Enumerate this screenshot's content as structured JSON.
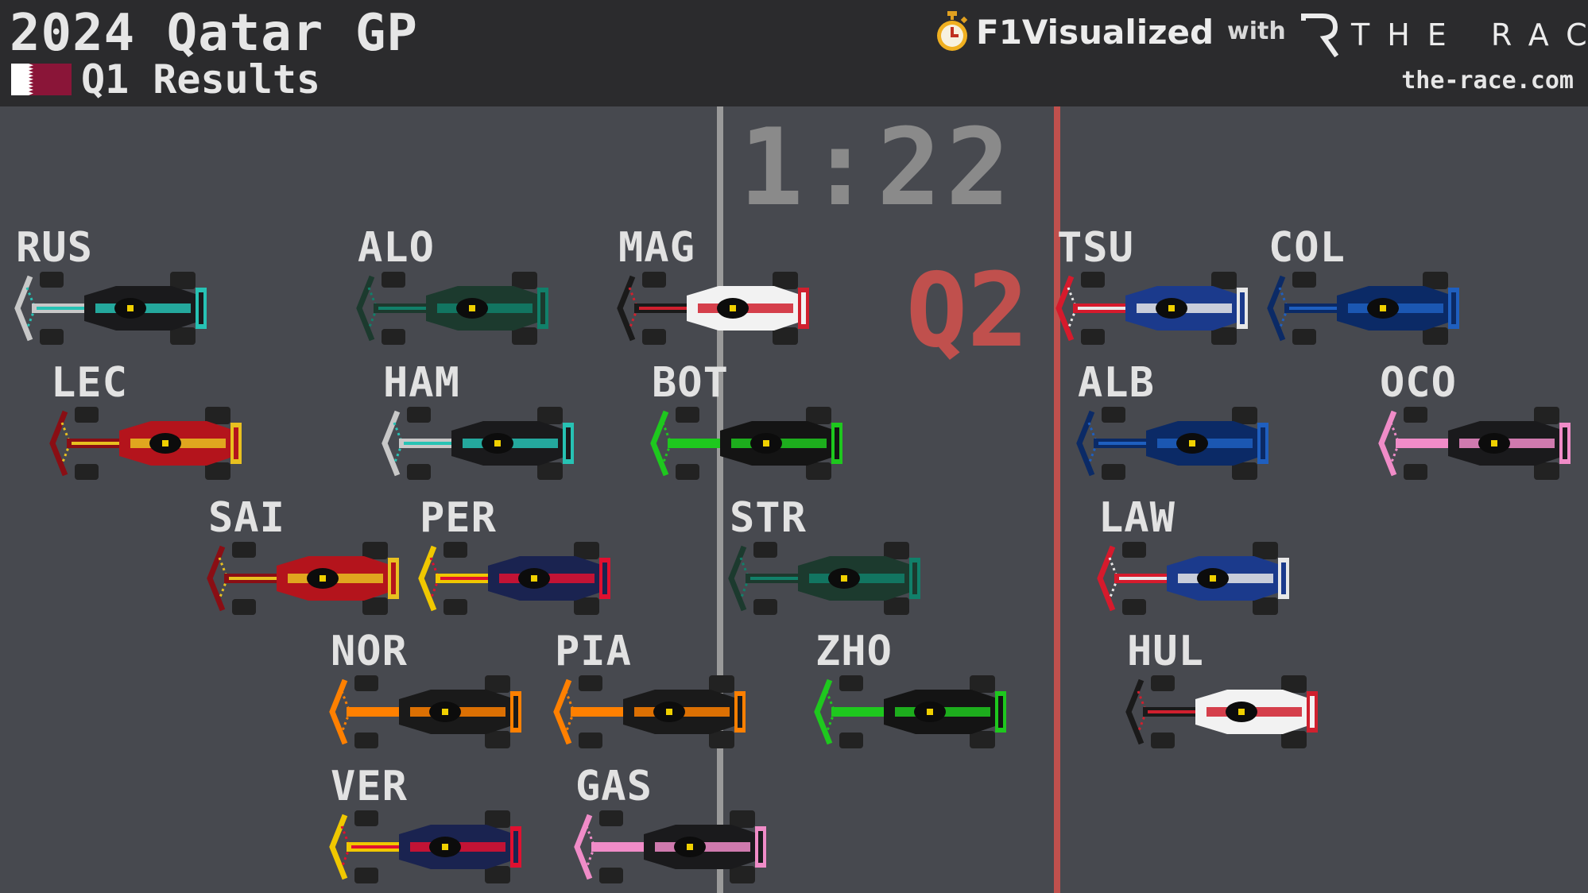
{
  "header": {
    "title": "2024 Qatar GP",
    "subtitle": "Q1 Results",
    "brand": "F1Visualized",
    "with_text": "with",
    "partner": "THE RACE",
    "url": "the-race.com"
  },
  "timer": "1:22",
  "cutoff_label": "Q2",
  "colors": {
    "header_bg": "#2b2b2d",
    "track_bg": "#47494f",
    "center_line": "#9a9a9a",
    "cutoff_line": "#c0504d",
    "cutoff_text": "#c0504d",
    "flag_white": "#ffffff",
    "flag_maroon": "#8a1538"
  },
  "icons": [
    "stopwatch-icon",
    "qatar-flag-icon",
    "the-race-logo-icon"
  ],
  "drivers": [
    {
      "code": "RUS",
      "team": "mercedes",
      "body": "#1a1a1c",
      "accent": "#27c2b4",
      "nose": "#c8c8c8",
      "row": 1
    },
    {
      "code": "ALO",
      "team": "aston-martin",
      "body": "#1c3a2e",
      "accent": "#11806a",
      "nose": "#1c3a2e",
      "row": 1
    },
    {
      "code": "MAG",
      "team": "haas",
      "body": "#f2f2f2",
      "accent": "#d0202e",
      "nose": "#1a1a1a",
      "row": 1
    },
    {
      "code": "TSU",
      "team": "rb",
      "body": "#1b3a8c",
      "accent": "#e8e8e8",
      "nose": "#d61a2c",
      "row": 1
    },
    {
      "code": "COL",
      "team": "williams",
      "body": "#0b2a66",
      "accent": "#1f5fbf",
      "nose": "#0b2a66",
      "row": 1
    },
    {
      "code": "LEC",
      "team": "ferrari",
      "body": "#b4141c",
      "accent": "#e8c020",
      "nose": "#8a0e14",
      "row": 2
    },
    {
      "code": "HAM",
      "team": "mercedes",
      "body": "#1a1a1c",
      "accent": "#27c2b4",
      "nose": "#c8c8c8",
      "row": 2
    },
    {
      "code": "BOT",
      "team": "sauber",
      "body": "#141414",
      "accent": "#1ec81e",
      "nose": "#1ec81e",
      "row": 2
    },
    {
      "code": "ALB",
      "team": "williams",
      "body": "#0b2a66",
      "accent": "#1f5fbf",
      "nose": "#0b2a66",
      "row": 2
    },
    {
      "code": "OCO",
      "team": "alpine",
      "body": "#1a1a1c",
      "accent": "#f08cc8",
      "nose": "#f08cc8",
      "row": 2
    },
    {
      "code": "SAI",
      "team": "ferrari",
      "body": "#b4141c",
      "accent": "#e8c020",
      "nose": "#8a0e14",
      "row": 3
    },
    {
      "code": "PER",
      "team": "red-bull",
      "body": "#1a2350",
      "accent": "#e01030",
      "nose": "#f0c800",
      "row": 3
    },
    {
      "code": "STR",
      "team": "aston-martin",
      "body": "#1c3a2e",
      "accent": "#11806a",
      "nose": "#1c3a2e",
      "row": 3
    },
    {
      "code": "LAW",
      "team": "rb",
      "body": "#1b3a8c",
      "accent": "#e8e8e8",
      "nose": "#d61a2c",
      "row": 3
    },
    {
      "code": "NOR",
      "team": "mclaren",
      "body": "#1a1a1a",
      "accent": "#ff8000",
      "nose": "#ff8000",
      "row": 4
    },
    {
      "code": "PIA",
      "team": "mclaren",
      "body": "#1a1a1a",
      "accent": "#ff8000",
      "nose": "#ff8000",
      "row": 4
    },
    {
      "code": "ZHO",
      "team": "sauber",
      "body": "#141414",
      "accent": "#1ec81e",
      "nose": "#1ec81e",
      "row": 4
    },
    {
      "code": "HUL",
      "team": "haas",
      "body": "#f2f2f2",
      "accent": "#d0202e",
      "nose": "#1a1a1a",
      "row": 4
    },
    {
      "code": "VER",
      "team": "red-bull",
      "body": "#1a2350",
      "accent": "#e01030",
      "nose": "#f0c800",
      "row": 5
    },
    {
      "code": "GAS",
      "team": "alpine",
      "body": "#1a1a1c",
      "accent": "#f08cc8",
      "nose": "#f08cc8",
      "row": 5
    }
  ]
}
